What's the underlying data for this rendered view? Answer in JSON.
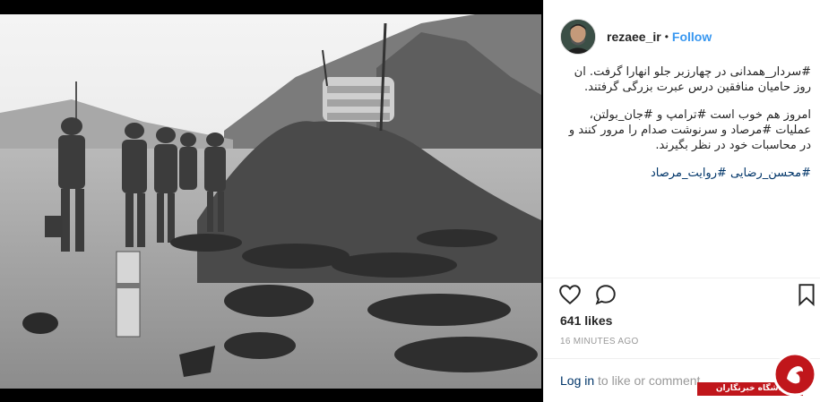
{
  "post": {
    "username": "rezaee_ir",
    "separator": "•",
    "follow_label": "Follow",
    "caption_lines": [
      {
        "id": "p1",
        "text": "#سردار_همدانی در چهارزبر جلو انهارا گرفت. ان روز حامیان منافقین درس عبرت بزرگی گرفتند."
      },
      {
        "id": "p2",
        "text": "امروز هم خوب است #ترامپ و #جان_بولتن، عملیات #مرصاد و سرنوشت صدام را مرور کنند و در محاسبات خود در نظر بگیرند."
      },
      {
        "id": "p3",
        "text": "#محسن_رضایی #روایت_مرصاد"
      }
    ],
    "likes": "641 likes",
    "timestamp": "16 MINUTES AGO",
    "login_link": "Log in",
    "login_suffix": " to like or comment."
  },
  "icons": {
    "like": "heart-icon",
    "comment": "comment-icon",
    "save": "bookmark-icon"
  },
  "watermark": {
    "text": "باشگاه خبرنگاران"
  },
  "colors": {
    "follow": "#3897f0",
    "hashtag": "#003569",
    "muted": "#999999",
    "watermark_red": "#c0161b"
  }
}
